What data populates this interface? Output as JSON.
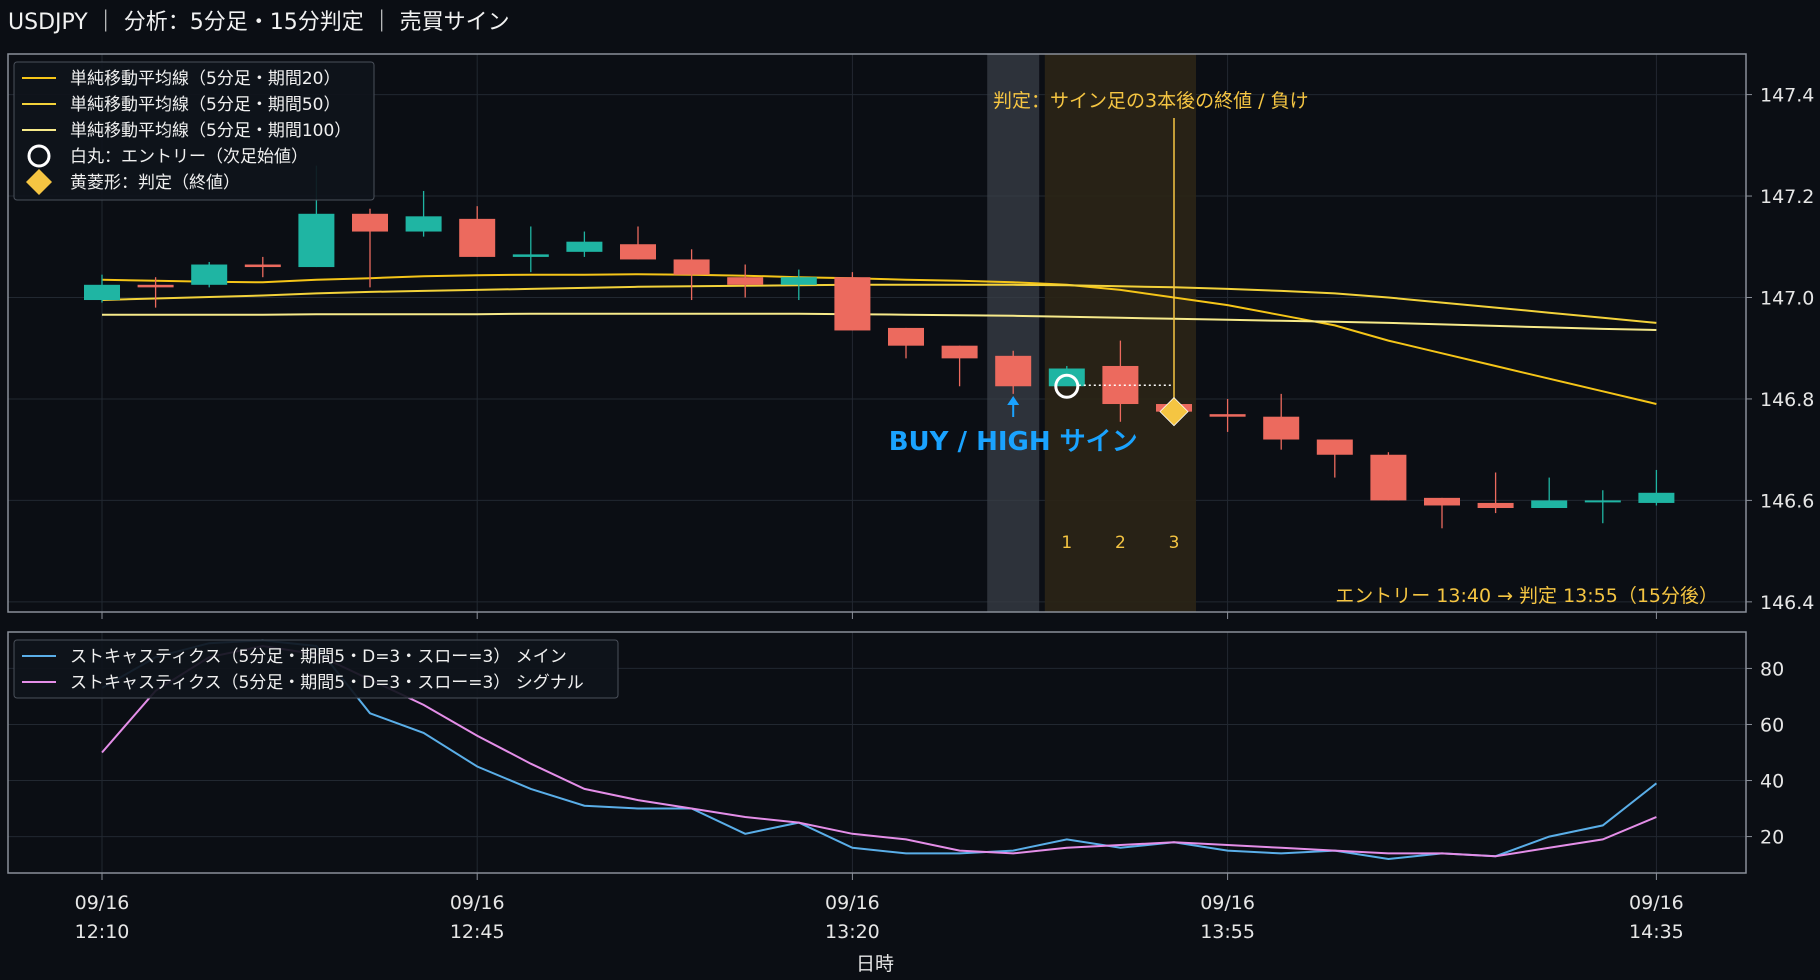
{
  "header": {
    "title": "USDJPY ｜ 分析：5分足・15分判定 ｜ 売買サイン"
  },
  "colors": {
    "background": "#0b0e14",
    "panel_border": "#8a8f99",
    "grid": "#222831",
    "bull": "#1fb5a3",
    "bear": "#ec6a5e",
    "ma20": "#f5c518",
    "ma50": "#f3d23a",
    "ma100": "#f7ea8a",
    "stoch_main": "#5aaee8",
    "stoch_signal": "#e48ee8",
    "signal_text": "#1aa3ff",
    "judge": "#f5c542"
  },
  "chart_data": [
    {
      "type": "candlestick",
      "title": "",
      "ylim": [
        146.38,
        147.48
      ],
      "y_ticks": [
        "146.4",
        "146.6",
        "146.8",
        "147.0",
        "147.2",
        "147.4"
      ],
      "x_ticks": [
        {
          "date": "09/16",
          "time": "12:10"
        },
        {
          "date": "09/16",
          "time": "12:45"
        },
        {
          "date": "09/16",
          "time": "13:20"
        },
        {
          "date": "09/16",
          "time": "13:55"
        },
        {
          "date": "09/16",
          "time": "14:35"
        }
      ],
      "xlabel": "日時",
      "candles": [
        {
          "time": "12:10",
          "open": 146.995,
          "high": 147.045,
          "low": 146.99,
          "close": 147.025
        },
        {
          "time": "12:15",
          "open": 147.025,
          "high": 147.04,
          "low": 146.98,
          "close": 147.02
        },
        {
          "time": "12:20",
          "open": 147.025,
          "high": 147.07,
          "low": 147.02,
          "close": 147.065
        },
        {
          "time": "12:25",
          "open": 147.065,
          "high": 147.08,
          "low": 147.04,
          "close": 147.06
        },
        {
          "time": "12:30",
          "open": 147.06,
          "high": 147.26,
          "low": 147.06,
          "close": 147.165
        },
        {
          "time": "12:35",
          "open": 147.165,
          "high": 147.175,
          "low": 147.02,
          "close": 147.13
        },
        {
          "time": "12:40",
          "open": 147.13,
          "high": 147.21,
          "low": 147.12,
          "close": 147.16
        },
        {
          "time": "12:45",
          "open": 147.155,
          "high": 147.18,
          "low": 147.08,
          "close": 147.08
        },
        {
          "time": "12:50",
          "open": 147.08,
          "high": 147.14,
          "low": 147.05,
          "close": 147.085
        },
        {
          "time": "12:55",
          "open": 147.09,
          "high": 147.13,
          "low": 147.08,
          "close": 147.11
        },
        {
          "time": "13:00",
          "open": 147.105,
          "high": 147.14,
          "low": 147.075,
          "close": 147.075
        },
        {
          "time": "13:05",
          "open": 147.075,
          "high": 147.095,
          "low": 146.995,
          "close": 147.045
        },
        {
          "time": "13:10",
          "open": 147.04,
          "high": 147.065,
          "low": 147.0,
          "close": 147.025
        },
        {
          "time": "13:15",
          "open": 147.025,
          "high": 147.055,
          "low": 146.995,
          "close": 147.04
        },
        {
          "time": "13:20",
          "open": 147.04,
          "high": 147.05,
          "low": 146.935,
          "close": 146.935
        },
        {
          "time": "13:25",
          "open": 146.94,
          "high": 146.94,
          "low": 146.88,
          "close": 146.905
        },
        {
          "time": "13:30",
          "open": 146.905,
          "high": 146.905,
          "low": 146.825,
          "close": 146.88
        },
        {
          "time": "13:35",
          "open": 146.885,
          "high": 146.895,
          "low": 146.81,
          "close": 146.825
        },
        {
          "time": "13:40",
          "open": 146.825,
          "high": 146.865,
          "low": 146.83,
          "close": 146.86
        },
        {
          "time": "13:45",
          "open": 146.865,
          "high": 146.915,
          "low": 146.755,
          "close": 146.79
        },
        {
          "time": "13:50",
          "open": 146.79,
          "high": 146.79,
          "low": 146.765,
          "close": 146.775
        },
        {
          "time": "13:55",
          "open": 146.77,
          "high": 146.8,
          "low": 146.735,
          "close": 146.765
        },
        {
          "time": "14:00",
          "open": 146.765,
          "high": 146.81,
          "low": 146.7,
          "close": 146.72
        },
        {
          "time": "14:05",
          "open": 146.72,
          "high": 146.72,
          "low": 146.645,
          "close": 146.69
        },
        {
          "time": "14:10",
          "open": 146.69,
          "high": 146.695,
          "low": 146.6,
          "close": 146.6
        },
        {
          "time": "14:15",
          "open": 146.605,
          "high": 146.605,
          "low": 146.545,
          "close": 146.59
        },
        {
          "time": "14:20",
          "open": 146.595,
          "high": 146.655,
          "low": 146.575,
          "close": 146.585
        },
        {
          "time": "14:25",
          "open": 146.585,
          "high": 146.645,
          "low": 146.585,
          "close": 146.6
        },
        {
          "time": "14:30",
          "open": 146.6,
          "high": 146.62,
          "low": 146.555,
          "close": 146.6
        },
        {
          "time": "14:35",
          "open": 146.595,
          "high": 146.66,
          "low": 146.59,
          "close": 146.615
        }
      ],
      "series": [
        {
          "name": "単純移動平均線（5分足・期間20）",
          "key": "ma20",
          "values": [
            147.035,
            147.033,
            147.031,
            147.03,
            147.035,
            147.038,
            147.042,
            147.044,
            147.045,
            147.045,
            147.046,
            147.045,
            147.043,
            147.04,
            147.038,
            147.035,
            147.033,
            147.03,
            147.025,
            147.015,
            147.0,
            146.985,
            146.965,
            146.945,
            146.915,
            146.89,
            146.865,
            146.84,
            146.815,
            146.79
          ]
        },
        {
          "name": "単純移動平均線（5分足・期間50）",
          "key": "ma50",
          "values": [
            146.995,
            146.998,
            147.001,
            147.004,
            147.008,
            147.011,
            147.013,
            147.015,
            147.017,
            147.019,
            147.021,
            147.022,
            147.023,
            147.024,
            147.025,
            147.025,
            147.025,
            147.025,
            147.024,
            147.022,
            147.02,
            147.017,
            147.013,
            147.008,
            147.0,
            146.99,
            146.98,
            146.97,
            146.96,
            146.95
          ]
        },
        {
          "name": "単純移動平均線（5分足・期間100）",
          "key": "ma100",
          "values": [
            146.966,
            146.966,
            146.966,
            146.966,
            146.967,
            146.967,
            146.967,
            146.967,
            146.968,
            146.968,
            146.968,
            146.968,
            146.968,
            146.968,
            146.967,
            146.966,
            146.965,
            146.964,
            146.962,
            146.96,
            146.958,
            146.956,
            146.954,
            146.952,
            146.95,
            146.947,
            146.944,
            146.941,
            146.938,
            146.936
          ]
        }
      ],
      "markers": [
        {
          "name": "白丸：エントリー（次足始値）",
          "shape": "circle",
          "time": "13:40",
          "value": 146.825
        },
        {
          "name": "黄菱形：判定（終値）",
          "shape": "diamond",
          "time": "13:50",
          "value": 146.775
        }
      ],
      "signal": {
        "time": "13:35",
        "label": "BUY / HIGH サイン"
      },
      "judgment_note": "判定：サイン足の3本後の終値 / 負け",
      "count_labels": [
        "1",
        "2",
        "3"
      ],
      "footer_note": "エントリー 13:40 → 判定 13:55（15分後）"
    },
    {
      "type": "line",
      "title": "",
      "ylim": [
        7,
        93
      ],
      "y_ticks": [
        "20",
        "40",
        "60",
        "80"
      ],
      "series": [
        {
          "name": "ストキャスティクス（5分足・期間5・D=3・スロー=3） メイン",
          "key": "stoch_main",
          "values": [
            73,
            84,
            89,
            90,
            88,
            64,
            57,
            45,
            37,
            31,
            30,
            30,
            21,
            25,
            16,
            14,
            14,
            15,
            19,
            16,
            18,
            15,
            14,
            15,
            12,
            14,
            13,
            20,
            24,
            39
          ]
        },
        {
          "name": "ストキャスティクス（5分足・期間5・D=3・スロー=3） シグナル",
          "key": "stoch_signal",
          "values": [
            50,
            72,
            84,
            88,
            85,
            76,
            67,
            56,
            46,
            37,
            33,
            30,
            27,
            25,
            21,
            19,
            15,
            14,
            16,
            17,
            18,
            17,
            16,
            15,
            14,
            14,
            13,
            16,
            19,
            27
          ]
        }
      ]
    }
  ]
}
